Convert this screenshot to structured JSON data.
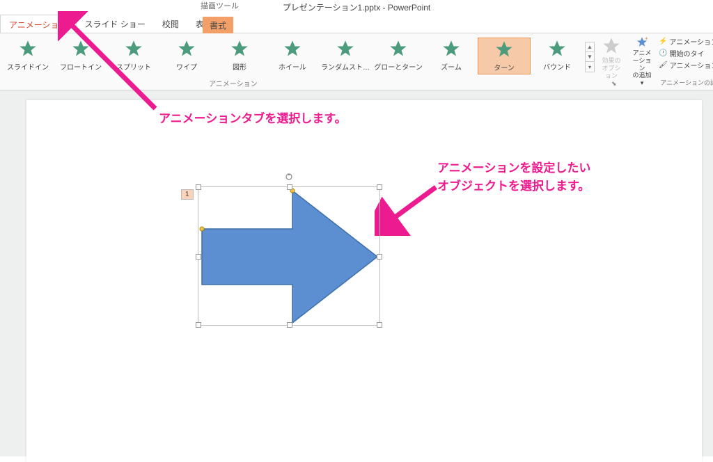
{
  "title": "プレゼンテーション1.pptx - PowerPoint",
  "drawing_tools_label": "描画ツール",
  "drawing_tools_tab": "書式",
  "tabs": {
    "animation": "アニメーション",
    "slideshow": "スライド ショー",
    "review": "校閲",
    "view": "表示"
  },
  "animations": {
    "slidein": "スライドイン",
    "floatin": "フロートイン",
    "split": "スプリット",
    "wipe": "ワイプ",
    "shape": "図形",
    "wheel": "ホイール",
    "randombars": "ランダムスト…",
    "growturn": "グローとターン",
    "zoom": "ズーム",
    "turn": "ターン",
    "bound": "バウンド"
  },
  "ribbon_group_label": "アニメーション",
  "effect_options": {
    "label1": "効果の",
    "label2": "オプション"
  },
  "add_animation": {
    "label1": "アニメーション",
    "label2": "の追加"
  },
  "right_items": {
    "animation_pane": "アニメーション",
    "trigger": "開始のタイ",
    "painter": "アニメーション"
  },
  "right_group_label": "アニメーションの詳",
  "annotation1": "アニメーションタブを選択します。",
  "annotation2_line1": "アニメーションを設定したい",
  "annotation2_line2": "オブジェクトを選択します。",
  "anim_tag_number": "1",
  "icons": {
    "lightning": "⚡",
    "clock": "🕐",
    "brush": "🖌"
  }
}
